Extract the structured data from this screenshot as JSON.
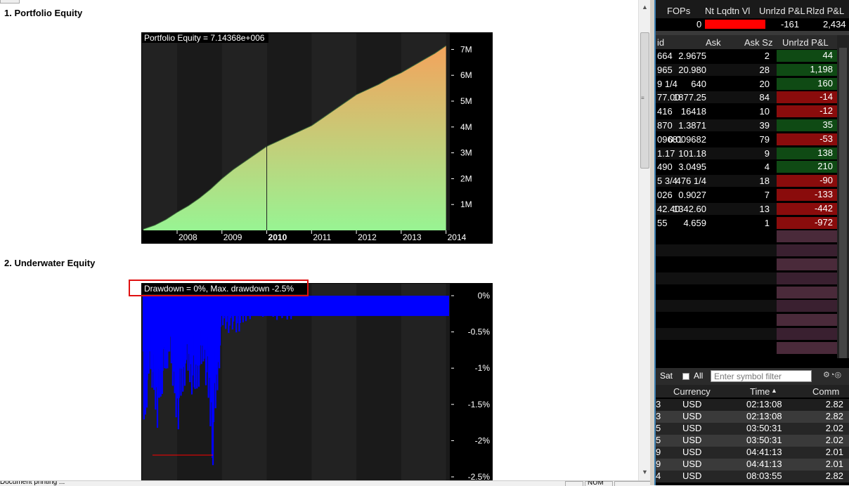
{
  "report": {
    "section1_title": "1. Portfolio Equity",
    "section2_title": "2. Underwater Equity",
    "status_text": "Document printing ... ",
    "status_num": "NUM"
  },
  "chart_data": [
    {
      "type": "area",
      "title": "Portfolio Equity = 7.14368e+006",
      "xlabel": "",
      "ylabel": "",
      "x_ticks": [
        "2008",
        "2009",
        "2010",
        "2011",
        "2012",
        "2013",
        "2014"
      ],
      "y_ticks": [
        "1M",
        "2M",
        "3M",
        "4M",
        "5M",
        "6M",
        "7M"
      ],
      "xlim": [
        2007.2,
        2014.1
      ],
      "ylim": [
        0,
        7500000
      ],
      "x": [
        2007.25,
        2007.5,
        2007.75,
        2008.0,
        2008.25,
        2008.5,
        2008.75,
        2009.0,
        2009.25,
        2009.5,
        2009.75,
        2010.0,
        2010.25,
        2010.5,
        2010.75,
        2011.0,
        2011.25,
        2011.5,
        2011.75,
        2012.0,
        2012.25,
        2012.5,
        2012.75,
        2013.0,
        2013.25,
        2013.5,
        2013.75,
        2014.0
      ],
      "values": [
        50000,
        200000,
        420000,
        700000,
        950000,
        1250000,
        1600000,
        2000000,
        2350000,
        2650000,
        2950000,
        3250000,
        3450000,
        3650000,
        3850000,
        4050000,
        4350000,
        4650000,
        4950000,
        5250000,
        5450000,
        5650000,
        5900000,
        6100000,
        6350000,
        6600000,
        6850000,
        7143680
      ],
      "colors": {
        "top": "#f4a35c",
        "bottom": "#98f493",
        "line": "#3a6a3a"
      }
    },
    {
      "type": "area",
      "title": "Drawdown = 0%, Max. drawdown -2.5%",
      "x_ticks": [],
      "y_ticks": [
        "0%",
        "-0.5%",
        "-1%",
        "-1.5%",
        "-2%",
        "-2.5%"
      ],
      "xlim": [
        2007.2,
        2014.1
      ],
      "ylim": [
        -2.5,
        0
      ],
      "x": [
        2007.25,
        2007.4,
        2007.55,
        2007.7,
        2007.85,
        2008.0,
        2008.2,
        2008.4,
        2008.6,
        2008.8,
        2009.0,
        2009.3,
        2009.6,
        2010.0,
        2010.4,
        2010.8,
        2011.2,
        2011.6,
        2012.0,
        2012.4,
        2012.8,
        2013.2,
        2013.6,
        2014.0
      ],
      "values": [
        -2.2,
        -1.1,
        -2.0,
        -1.3,
        -0.9,
        -2.1,
        -1.2,
        -1.6,
        -1.0,
        -2.5,
        -0.5,
        -0.6,
        -0.35,
        -0.3,
        -0.4,
        -0.25,
        -0.3,
        -0.2,
        -0.25,
        -0.2,
        -0.15,
        -0.18,
        -0.12,
        -0.15
      ],
      "max_drawdown_line": {
        "from": 2007.45,
        "to": 2008.8,
        "value": -2.2
      },
      "colors": {
        "fill": "#0000ff",
        "marker": "#ff0000"
      }
    }
  ],
  "tws": {
    "account_headers": [
      "FOPs",
      "Nt Lqdtn Vl",
      "Unrlzd P&L",
      "Rlzd P&L"
    ],
    "account_values": {
      "fops": "0",
      "unrlzd": "-161",
      "rlzd": "2,434"
    },
    "position_headers": [
      "id",
      "Ask",
      "Ask Sz",
      "Unrlzd P&L"
    ],
    "positions": [
      {
        "bid": "664",
        "ask": "2.9675",
        "ask_sz": "2",
        "pnl": "44",
        "pos": true
      },
      {
        "bid": "965",
        "ask": "20.980",
        "ask_sz": "28",
        "pnl": "1,198",
        "pos": true
      },
      {
        "bid": "9 1/4",
        "ask": "640",
        "ask_sz": "20",
        "pnl": "160",
        "pos": true
      },
      {
        "bid": "77.00",
        "ask": "1877.25",
        "ask_sz": "84",
        "pnl": "-14",
        "pos": false
      },
      {
        "bid": "416",
        "ask": "16418",
        "ask_sz": "10",
        "pnl": "-12",
        "pos": false
      },
      {
        "bid": "870",
        "ask": "1.3871",
        "ask_sz": "39",
        "pnl": "35",
        "pos": true
      },
      {
        "bid": "09681",
        "ask": "0.009682",
        "ask_sz": "79",
        "pnl": "-53",
        "pos": false
      },
      {
        "bid": "1.17",
        "ask": "101.18",
        "ask_sz": "9",
        "pnl": "138",
        "pos": true
      },
      {
        "bid": "490",
        "ask": "3.0495",
        "ask_sz": "4",
        "pnl": "210",
        "pos": true
      },
      {
        "bid": "5 3/4",
        "ask": "476 1/4",
        "ask_sz": "18",
        "pnl": "-90",
        "pos": false
      },
      {
        "bid": "026",
        "ask": "0.9027",
        "ask_sz": "7",
        "pnl": "-133",
        "pos": false
      },
      {
        "bid": "42.40",
        "ask": "1342.60",
        "ask_sz": "13",
        "pnl": "-442",
        "pos": false
      },
      {
        "bid": "55",
        "ask": "4.659",
        "ask_sz": "1",
        "pnl": "-972",
        "pos": false
      }
    ],
    "trades_toolbar": {
      "sat": "Sat",
      "all": "All",
      "filter_placeholder": "Enter symbol filter"
    },
    "trade_headers": [
      "Currency",
      "Time",
      "Comm"
    ],
    "trades": [
      {
        "pre": "3",
        "currency": "USD",
        "time": "02:13:08",
        "comm": "2.82"
      },
      {
        "pre": "3",
        "currency": "USD",
        "time": "02:13:08",
        "comm": "2.82"
      },
      {
        "pre": "5",
        "currency": "USD",
        "time": "03:50:31",
        "comm": "2.02"
      },
      {
        "pre": "5",
        "currency": "USD",
        "time": "03:50:31",
        "comm": "2.02"
      },
      {
        "pre": "9",
        "currency": "USD",
        "time": "04:41:13",
        "comm": "2.01"
      },
      {
        "pre": "9",
        "currency": "USD",
        "time": "04:41:13",
        "comm": "2.01"
      },
      {
        "pre": "4",
        "currency": "USD",
        "time": "08:03:55",
        "comm": "2.82"
      }
    ],
    "colors": {
      "green": "#0f4a14",
      "red": "#8a0c0c",
      "empty_pnl": "#4a2a3a"
    }
  }
}
